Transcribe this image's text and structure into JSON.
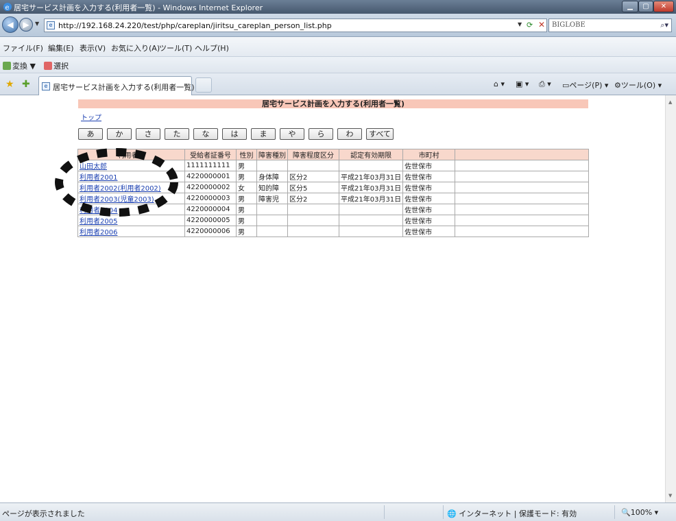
{
  "window": {
    "title": "居宅サービス計画を入力する(利用者一覧) - Windows Internet Explorer"
  },
  "address": {
    "url": "http://192.168.24.220/test/php/careplan/jiritsu_careplan_person_list.php",
    "search_provider": "BIGLOBE"
  },
  "menu": {
    "items": [
      "ファイル(F)",
      "編集(E)",
      "表示(V)",
      "お気に入り(A)",
      "ツール(T)",
      "ヘルプ(H)"
    ]
  },
  "linkbar": {
    "convert": "変換",
    "select": "選択"
  },
  "tab": {
    "label": "居宅サービス計画を入力する(利用者一覧)"
  },
  "commands": {
    "page": "ページ(P)",
    "tools": "ツール(O)"
  },
  "page": {
    "heading": "居宅サービス計画を入力する(利用者一覧)",
    "top_link": "トップ",
    "kana_buttons": [
      "あ",
      "か",
      "さ",
      "た",
      "な",
      "は",
      "ま",
      "や",
      "ら",
      "わ",
      "すべて"
    ]
  },
  "table": {
    "headers": [
      "利用者名",
      "受給者証番号",
      "性別",
      "障害種別",
      "障害程度区分",
      "認定有効期限",
      "市町村",
      ""
    ],
    "rows": [
      [
        "山田太郎",
        "1111111111",
        "男",
        "",
        "",
        "",
        "佐世保市",
        ""
      ],
      [
        "利用者2001",
        "4220000001",
        "男",
        "身体障",
        "区分2",
        "平成21年03月31日",
        "佐世保市",
        ""
      ],
      [
        "利用者2002(利用者2002)",
        "4220000002",
        "女",
        "知的障",
        "区分5",
        "平成21年03月31日",
        "佐世保市",
        ""
      ],
      [
        "利用者2003(児童2003)",
        "4220000003",
        "男",
        "障害児",
        "区分2",
        "平成21年03月31日",
        "佐世保市",
        ""
      ],
      [
        "利用者2004",
        "4220000004",
        "男",
        "",
        "",
        "",
        "佐世保市",
        ""
      ],
      [
        "利用者2005",
        "4220000005",
        "男",
        "",
        "",
        "",
        "佐世保市",
        ""
      ],
      [
        "利用者2006",
        "4220000006",
        "男",
        "",
        "",
        "",
        "佐世保市",
        ""
      ]
    ]
  },
  "status": {
    "text": "ページが表示されました",
    "zone": "インターネット | 保護モード: 有効",
    "zoom": "100%"
  },
  "colors": {
    "heading_bg": "#f8c7b8",
    "header_bg": "#f8d8cc",
    "link": "#1a3fb0"
  }
}
